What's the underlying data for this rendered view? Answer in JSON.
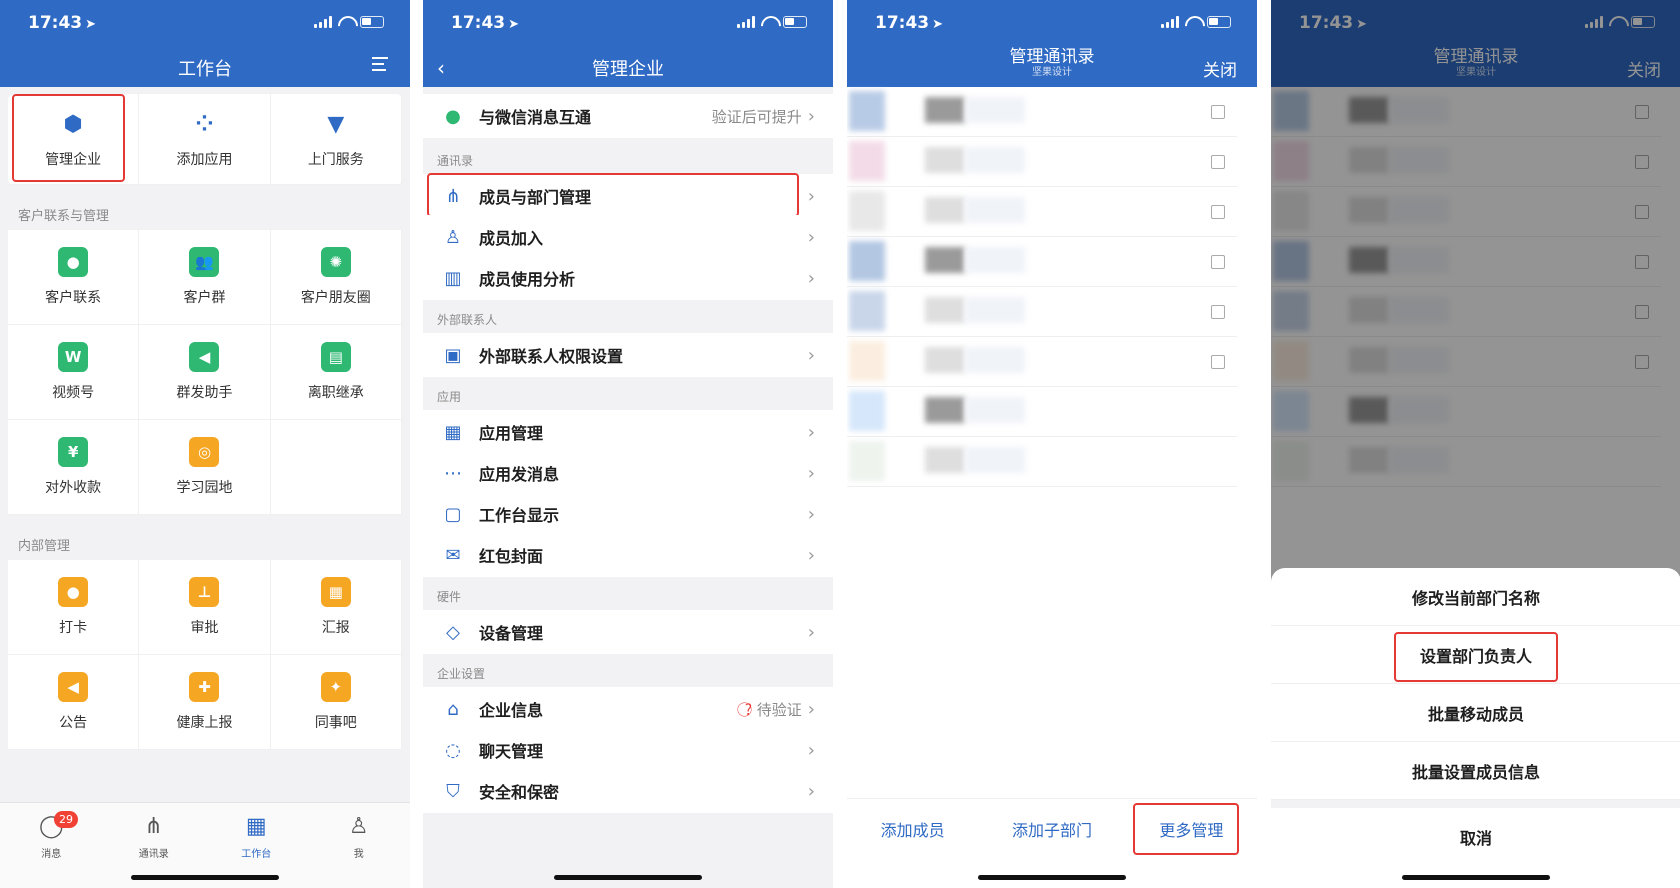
{
  "status_time": "17:43",
  "phone1": {
    "title": "工作台",
    "top_tiles": [
      {
        "label": "管理企业",
        "icon": "hexagon-icon",
        "color": "#2f6ac4"
      },
      {
        "label": "添加应用",
        "icon": "add-apps-icon",
        "color": "#2f6ac4"
      },
      {
        "label": "上门服务",
        "icon": "tie-icon",
        "color": "#2f6ac4"
      }
    ],
    "section_customer": "客户联系与管理",
    "customer_tiles": [
      {
        "label": "客户联系",
        "icon": "chat-icon",
        "color": "#2eb872"
      },
      {
        "label": "客户群",
        "icon": "group-icon",
        "color": "#2eb872"
      },
      {
        "label": "客户朋友圈",
        "icon": "aperture-icon",
        "color": "#2eb872"
      },
      {
        "label": "视频号",
        "icon": "video-icon",
        "color": "#2eb872"
      },
      {
        "label": "群发助手",
        "icon": "megaphone-icon",
        "color": "#2eb872"
      },
      {
        "label": "离职继承",
        "icon": "doc-icon",
        "color": "#2eb872"
      },
      {
        "label": "对外收款",
        "icon": "yen-icon",
        "color": "#2eb872"
      },
      {
        "label": "学习园地",
        "icon": "planet-icon",
        "color": "#f5a623"
      }
    ],
    "section_internal": "内部管理",
    "internal_tiles": [
      {
        "label": "打卡",
        "icon": "location-icon",
        "color": "#f5a623"
      },
      {
        "label": "审批",
        "icon": "stamp-icon",
        "color": "#f5a623"
      },
      {
        "label": "汇报",
        "icon": "report-icon",
        "color": "#f5a623"
      },
      {
        "label": "公告",
        "icon": "announce-icon",
        "color": "#f5a623"
      },
      {
        "label": "健康上报",
        "icon": "health-icon",
        "color": "#f5a623"
      },
      {
        "label": "同事吧",
        "icon": "share-icon",
        "color": "#f5a623"
      }
    ],
    "tabs": [
      {
        "label": "消息",
        "icon": "chat-bubble-icon",
        "badge": "29"
      },
      {
        "label": "通讯录",
        "icon": "org-icon"
      },
      {
        "label": "工作台",
        "icon": "grid-icon",
        "active": true
      },
      {
        "label": "我",
        "icon": "person-icon"
      }
    ]
  },
  "phone2": {
    "title": "管理企业",
    "wechat_row": {
      "label": "与微信消息互通",
      "value": "验证后可提升"
    },
    "groups": [
      {
        "label": "通讯录",
        "rows": [
          "成员与部门管理",
          "成员加入",
          "成员使用分析"
        ]
      },
      {
        "label": "外部联系人",
        "rows": [
          "外部联系人权限设置"
        ]
      },
      {
        "label": "应用",
        "rows": [
          "应用管理",
          "应用发消息",
          "工作台显示",
          "红包封面"
        ]
      },
      {
        "label": "硬件",
        "rows": [
          "设备管理"
        ]
      },
      {
        "label": "企业设置",
        "rows": [
          "企业信息",
          "聊天管理",
          "安全和保密"
        ]
      }
    ],
    "company_info_value": "待验证"
  },
  "phone3": {
    "title": "管理通讯录",
    "subtitle": "坚果设计",
    "close": "关闭",
    "actions": [
      "添加成员",
      "添加子部门",
      "更多管理"
    ]
  },
  "phone4": {
    "title": "管理通讯录",
    "subtitle": "坚果设计",
    "close": "关闭",
    "sheet_items": [
      "修改当前部门名称",
      "设置部门负责人",
      "批量移动成员",
      "批量设置成员信息"
    ],
    "cancel": "取消"
  }
}
